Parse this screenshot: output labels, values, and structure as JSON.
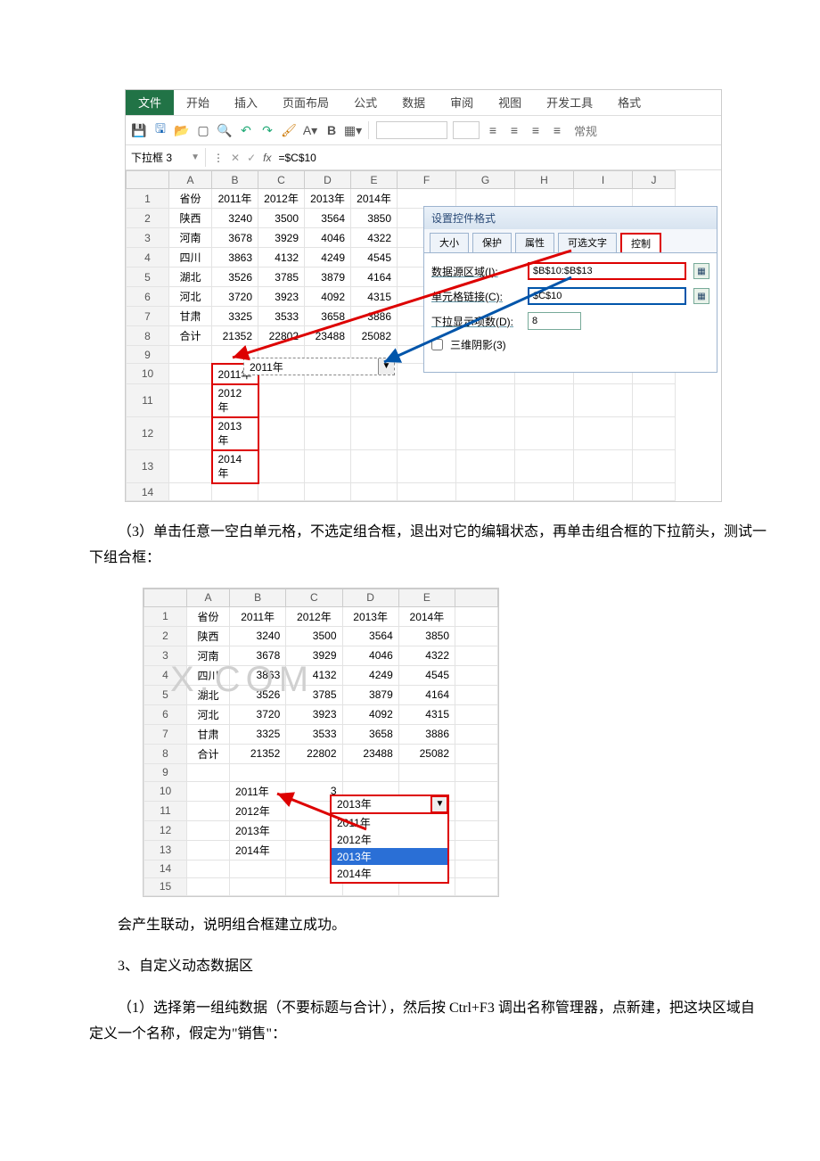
{
  "ribbon": {
    "tabs": [
      "文件",
      "开始",
      "插入",
      "页面布局",
      "公式",
      "数据",
      "审阅",
      "视图",
      "开发工具",
      "格式"
    ],
    "format_label": "常规"
  },
  "namebox": {
    "value": "下拉框 3"
  },
  "formula": {
    "value": "=$C$10"
  },
  "grid1": {
    "cols": [
      "A",
      "B",
      "C",
      "D",
      "E",
      "F",
      "G",
      "H",
      "I",
      "J"
    ],
    "rows": [
      {
        "n": "1",
        "A": "省份",
        "B": "2011年",
        "C": "2012年",
        "D": "2013年",
        "E": "2014年"
      },
      {
        "n": "2",
        "A": "陕西",
        "B": "3240",
        "C": "3500",
        "D": "3564",
        "E": "3850"
      },
      {
        "n": "3",
        "A": "河南",
        "B": "3678",
        "C": "3929",
        "D": "4046",
        "E": "4322"
      },
      {
        "n": "4",
        "A": "四川",
        "B": "3863",
        "C": "4132",
        "D": "4249",
        "E": "4545"
      },
      {
        "n": "5",
        "A": "湖北",
        "B": "3526",
        "C": "3785",
        "D": "3879",
        "E": "4164"
      },
      {
        "n": "6",
        "A": "河北",
        "B": "3720",
        "C": "3923",
        "D": "4092",
        "E": "4315"
      },
      {
        "n": "7",
        "A": "甘肃",
        "B": "3325",
        "C": "3533",
        "D": "3658",
        "E": "3886"
      },
      {
        "n": "8",
        "A": "合计",
        "B": "21352",
        "C": "22802",
        "D": "23488",
        "E": "25082"
      },
      {
        "n": "9"
      },
      {
        "n": "10",
        "B": "2011年"
      },
      {
        "n": "11",
        "B": "2012年"
      },
      {
        "n": "12",
        "B": "2013年"
      },
      {
        "n": "13",
        "B": "2014年"
      },
      {
        "n": "14"
      }
    ]
  },
  "dialog": {
    "title": "设置控件格式",
    "tabs": [
      "大小",
      "保护",
      "属性",
      "可选文字",
      "控制"
    ],
    "fields": {
      "src_label": "数据源区域(I):",
      "src_value": "$B$10:$B$13",
      "link_label": "单元格链接(C):",
      "link_value": "$C$10",
      "count_label": "下拉显示项数(D):",
      "count_value": "8",
      "shadow_label": "三维阴影(3)"
    }
  },
  "combo1": {
    "selected": "2011年"
  },
  "para1": "（3）单击任意一空白单元格，不选定组合框，退出对它的编辑状态，再单击组合框的下拉箭头，测试一下组合框：",
  "grid2": {
    "cols": [
      "A",
      "B",
      "C",
      "D",
      "E"
    ],
    "rows": [
      {
        "n": "1",
        "A": "省份",
        "B": "2011年",
        "C": "2012年",
        "D": "2013年",
        "E": "2014年"
      },
      {
        "n": "2",
        "A": "陕西",
        "B": "3240",
        "C": "3500",
        "D": "3564",
        "E": "3850"
      },
      {
        "n": "3",
        "A": "河南",
        "B": "3678",
        "C": "3929",
        "D": "4046",
        "E": "4322"
      },
      {
        "n": "4",
        "A": "四川",
        "B": "3863",
        "C": "4132",
        "D": "4249",
        "E": "4545"
      },
      {
        "n": "5",
        "A": "湖北",
        "B": "3526",
        "C": "3785",
        "D": "3879",
        "E": "4164"
      },
      {
        "n": "6",
        "A": "河北",
        "B": "3720",
        "C": "3923",
        "D": "4092",
        "E": "4315"
      },
      {
        "n": "7",
        "A": "甘肃",
        "B": "3325",
        "C": "3533",
        "D": "3658",
        "E": "3886"
      },
      {
        "n": "8",
        "A": "合计",
        "B": "21352",
        "C": "22802",
        "D": "23488",
        "E": "25082"
      },
      {
        "n": "9"
      },
      {
        "n": "10",
        "B": "2011年",
        "C": "3"
      },
      {
        "n": "11",
        "B": "2012年"
      },
      {
        "n": "12",
        "B": "2013年"
      },
      {
        "n": "13",
        "B": "2014年"
      },
      {
        "n": "14"
      },
      {
        "n": "15"
      }
    ]
  },
  "combo2": {
    "selected": "2013年",
    "options": [
      "2011年",
      "2012年",
      "2013年",
      "2014年"
    ]
  },
  "watermark": "X.COM",
  "para2": "会产生联动，说明组合框建立成功。",
  "para3": "3、自定义动态数据区",
  "para4": "（1）选择第一组纯数据（不要标题与合计），然后按 Ctrl+F3 调出名称管理器，点新建，把这块区域自定义一个名称，假定为\"销售\"："
}
